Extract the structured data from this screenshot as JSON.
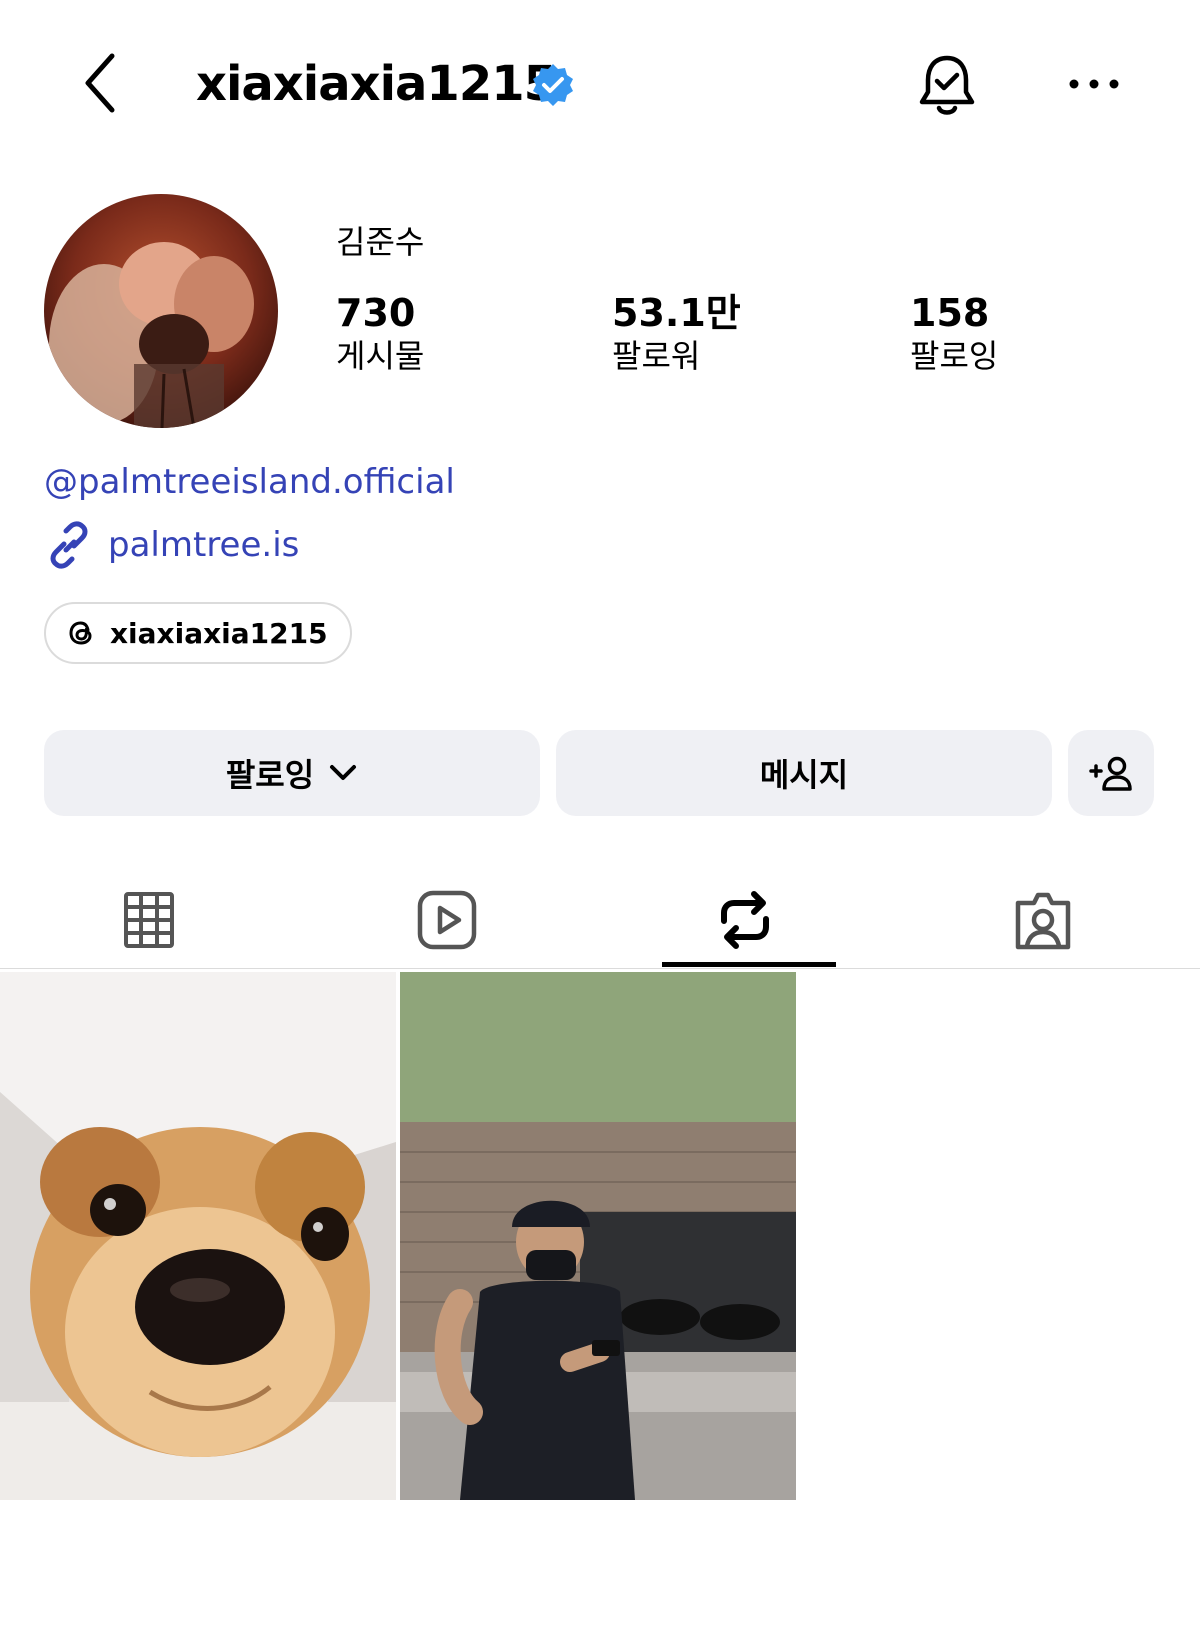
{
  "header": {
    "username": "xiaxiaxia1215",
    "verified": true,
    "back_icon": "chevron-left-icon",
    "bell_icon": "notification-bell-icon",
    "more_icon": "more-horizontal-icon"
  },
  "profile": {
    "display_name": "김준수",
    "stats": [
      {
        "value": "730",
        "label": "게시물"
      },
      {
        "value": "53.1만",
        "label": "팔로워"
      },
      {
        "value": "158",
        "label": "팔로잉"
      }
    ],
    "mention": "@palmtreeisland.official",
    "website": "palmtree.is",
    "threads_handle": "xiaxiaxia1215"
  },
  "actions": {
    "following_label": "팔로잉",
    "message_label": "메시지",
    "add_icon": "add-person-icon"
  },
  "tabs": [
    {
      "icon": "grid-icon",
      "active": false
    },
    {
      "icon": "reels-icon",
      "active": false
    },
    {
      "icon": "repost-icon",
      "active": true
    },
    {
      "icon": "tagged-icon",
      "active": false
    }
  ],
  "posts": [
    {
      "subject": "puppy-in-box"
    },
    {
      "subject": "man-in-cap-with-phone"
    }
  ],
  "colors": {
    "link": "#3543b6",
    "verified": "#3797f0",
    "button_bg": "#eff0f4",
    "border": "#dbdbdb"
  }
}
